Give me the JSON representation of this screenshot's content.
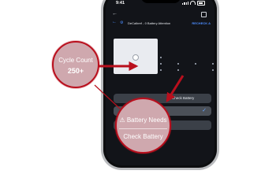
{
  "status_bar": {
    "time": "9:41"
  },
  "app_nav": {
    "title": "DeCalbref - 0 Battery Attention",
    "action": "RECHECK A"
  },
  "card": {
    "text": "Check Battery"
  },
  "callouts": {
    "left": {
      "line1": "Cycle Count",
      "line2": "250+"
    },
    "center": {
      "line1": "⚠ Battery Needs",
      "line2": "Check Battery"
    }
  },
  "colors": {
    "accent_red": "#b90f1d",
    "callout_fill": "#cfa8ae",
    "screen_bg": "#121419",
    "link_blue": "#4c8dff"
  },
  "icons": [
    "back-arrow-icon",
    "menu-icon",
    "gear-icon",
    "check-icon",
    "warning-icon"
  ]
}
